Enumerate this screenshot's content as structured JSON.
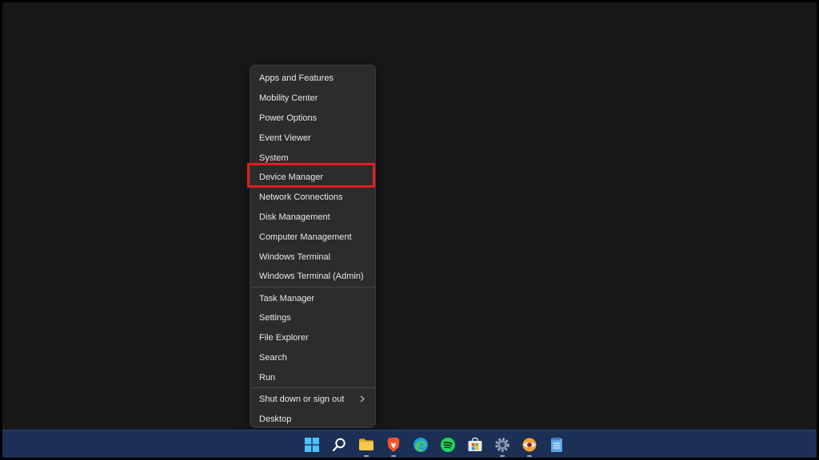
{
  "menu": {
    "group1": [
      "Apps and Features",
      "Mobility Center",
      "Power Options",
      "Event Viewer",
      "System",
      "Device Manager",
      "Network Connections",
      "Disk Management",
      "Computer Management",
      "Windows Terminal",
      "Windows Terminal (Admin)"
    ],
    "group2": [
      "Task Manager",
      "Settings",
      "File Explorer",
      "Search",
      "Run"
    ],
    "group3": [
      "Shut down or sign out",
      "Desktop"
    ]
  },
  "colors": {
    "highlight_border": "#e11d1d",
    "taskbar": "#1c2f55",
    "menu_bg": "#2c2c2c"
  },
  "taskbar": {
    "icons": [
      "windows-start-icon",
      "search-icon",
      "file-explorer-icon",
      "brave-browser-icon",
      "edge-browser-icon",
      "spotify-icon",
      "microsoft-store-icon",
      "settings-gear-icon",
      "photo-app-icon",
      "notepad-icon"
    ]
  }
}
